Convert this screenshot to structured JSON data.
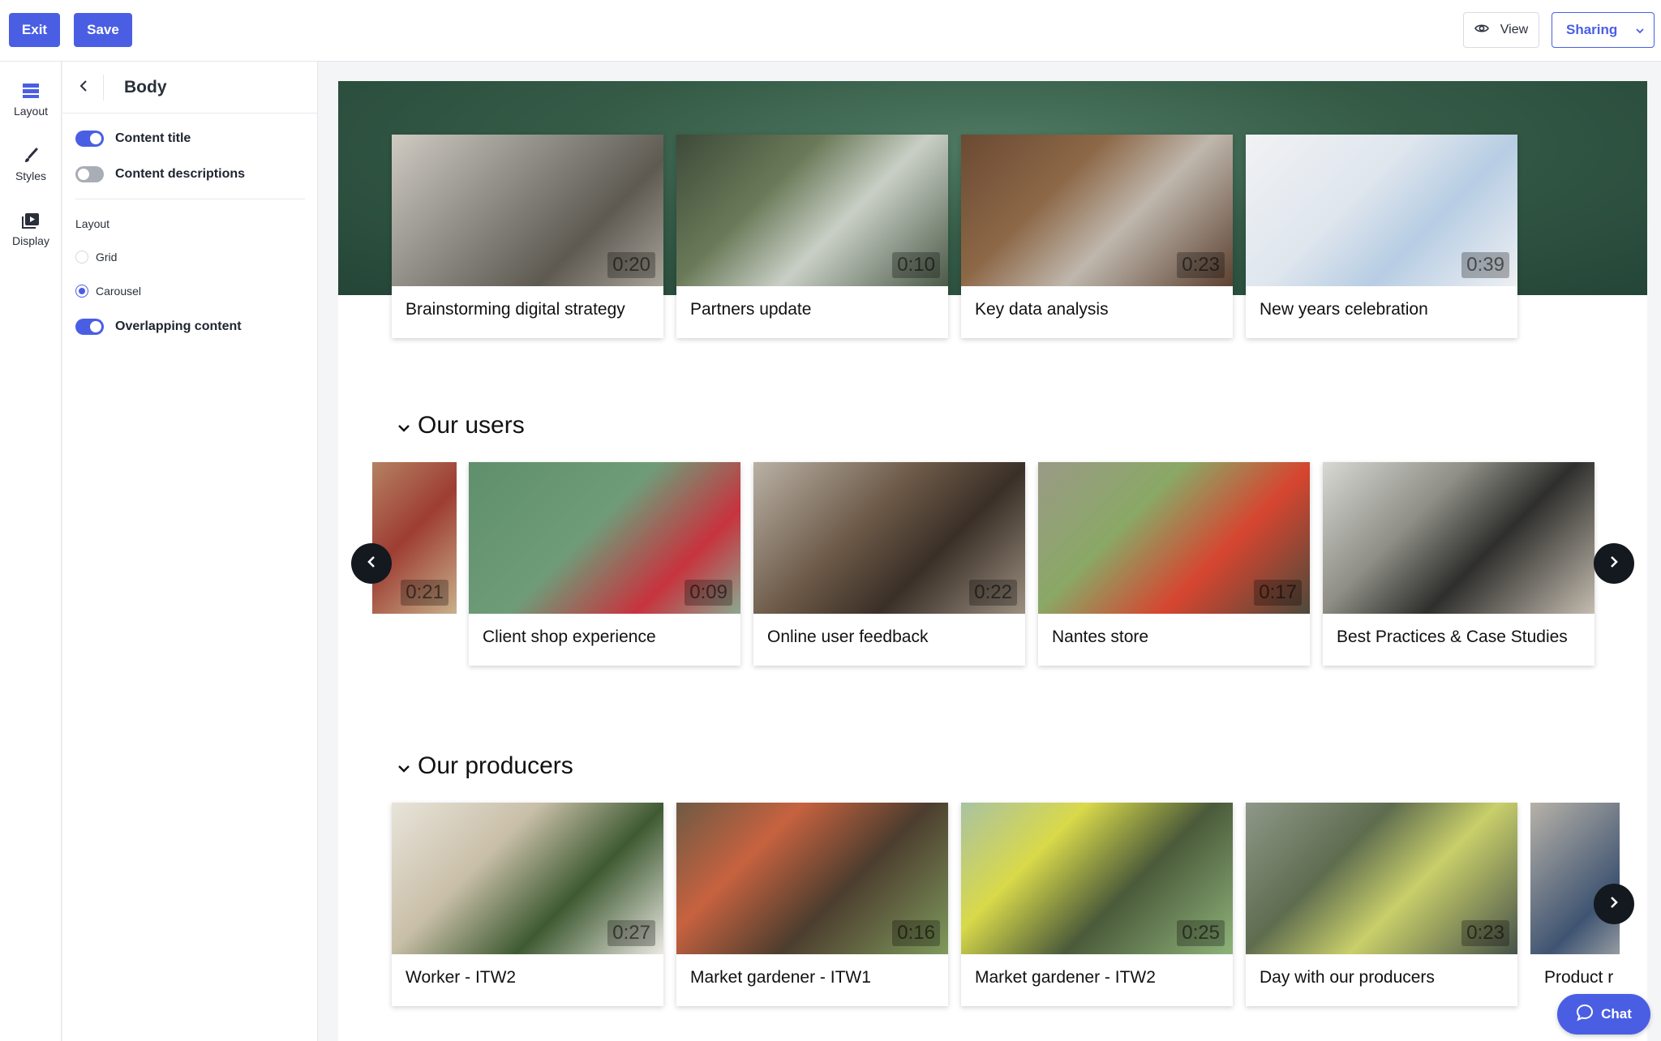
{
  "toolbar": {
    "exit_label": "Exit",
    "save_label": "Save",
    "view_label": "View",
    "sharing_label": "Sharing"
  },
  "rail": {
    "items": [
      {
        "label": "Layout",
        "icon": "layout-icon"
      },
      {
        "label": "Styles",
        "icon": "brush-icon"
      },
      {
        "label": "Display",
        "icon": "display-icon"
      }
    ]
  },
  "panel": {
    "title": "Body",
    "content_title_label": "Content title",
    "content_title_on": true,
    "content_descriptions_label": "Content descriptions",
    "content_descriptions_on": false,
    "layout_label": "Layout",
    "layout_options": [
      "Grid",
      "Carousel"
    ],
    "layout_selected": "Carousel",
    "overlapping_label": "Overlapping content",
    "overlapping_on": true
  },
  "hero": {
    "cards": [
      {
        "title": "Brainstorming digital strategy",
        "duration": "0:20"
      },
      {
        "title": "Partners update",
        "duration": "0:10"
      },
      {
        "title": "Key data analysis",
        "duration": "0:23"
      },
      {
        "title": "New years celebration",
        "duration": "0:39"
      }
    ]
  },
  "users": {
    "heading": "Our users",
    "partial_card": {
      "duration": "0:21"
    },
    "cards": [
      {
        "title": "Client shop experience",
        "duration": "0:09"
      },
      {
        "title": "Online user feedback",
        "duration": "0:22"
      },
      {
        "title": "Nantes store",
        "duration": "0:17"
      },
      {
        "title": "Best Practices & Case Studies",
        "duration": ""
      }
    ]
  },
  "producers": {
    "heading": "Our producers",
    "cards": [
      {
        "title": "Worker - ITW2",
        "duration": "0:27"
      },
      {
        "title": "Market gardener - ITW1",
        "duration": "0:16"
      },
      {
        "title": "Market gardener - ITW2",
        "duration": "0:25"
      },
      {
        "title": "Day with our producers",
        "duration": "0:23"
      }
    ],
    "partial_card": {
      "title": "Product r"
    }
  },
  "chat_label": "Chat",
  "colors": {
    "accent": "#4a5ee4",
    "hero_band": "#355b47",
    "nav_arrow": "#14181f"
  }
}
